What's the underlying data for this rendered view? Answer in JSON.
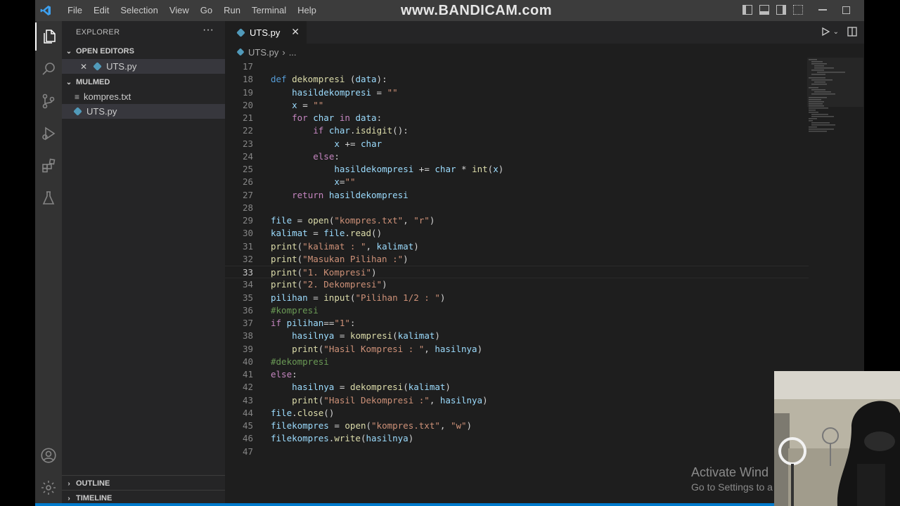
{
  "watermark": "www.BANDICAM.com",
  "menu": [
    "File",
    "Edit",
    "Selection",
    "View",
    "Go",
    "Run",
    "Terminal",
    "Help"
  ],
  "sidebar": {
    "title": "EXPLORER",
    "more": "···",
    "open_editors_label": "OPEN EDITORS",
    "open_editor_file": "UTS.py",
    "folder_label": "MULMED",
    "files": [
      "kompres.txt",
      "UTS.py"
    ],
    "outline_label": "OUTLINE",
    "timeline_label": "TIMELINE"
  },
  "tab": {
    "label": "UTS.py",
    "close": "✕"
  },
  "breadcrumb": {
    "file": "UTS.py",
    "sep": "›",
    "rest": "..."
  },
  "code_lines": [
    {
      "n": "17",
      "text": ""
    },
    {
      "n": "18",
      "text": "def dekompresi (data):"
    },
    {
      "n": "19",
      "text": "    hasildekompresi = \"\""
    },
    {
      "n": "20",
      "text": "    x = \"\""
    },
    {
      "n": "21",
      "text": "    for char in data:"
    },
    {
      "n": "22",
      "text": "        if char.isdigit():"
    },
    {
      "n": "23",
      "text": "            x += char"
    },
    {
      "n": "24",
      "text": "        else:"
    },
    {
      "n": "25",
      "text": "            hasildekompresi += char * int(x)"
    },
    {
      "n": "26",
      "text": "            x=\"\""
    },
    {
      "n": "27",
      "text": "    return hasildekompresi"
    },
    {
      "n": "28",
      "text": ""
    },
    {
      "n": "29",
      "text": "file = open(\"kompres.txt\", \"r\")"
    },
    {
      "n": "30",
      "text": "kalimat = file.read()"
    },
    {
      "n": "31",
      "text": "print(\"kalimat : \", kalimat)"
    },
    {
      "n": "32",
      "text": "print(\"Masukan Pilihan :\")"
    },
    {
      "n": "33",
      "text": "print(\"1. Kompresi\")"
    },
    {
      "n": "34",
      "text": "print(\"2. Dekompresi\")"
    },
    {
      "n": "35",
      "text": "pilihan = input(\"Pilihan 1/2 : \")"
    },
    {
      "n": "36",
      "text": "#kompresi"
    },
    {
      "n": "37",
      "text": "if pilihan==\"1\":"
    },
    {
      "n": "38",
      "text": "    hasilnya = kompresi(kalimat)"
    },
    {
      "n": "39",
      "text": "    print(\"Hasil Kompresi : \", hasilnya)"
    },
    {
      "n": "40",
      "text": "#dekompresi"
    },
    {
      "n": "41",
      "text": "else:"
    },
    {
      "n": "42",
      "text": "    hasilnya = dekompresi(kalimat)"
    },
    {
      "n": "43",
      "text": "    print(\"Hasil Dekompresi :\", hasilnya)"
    },
    {
      "n": "44",
      "text": "file.close()"
    },
    {
      "n": "45",
      "text": "filekompres = open(\"kompres.txt\", \"w\")"
    },
    {
      "n": "46",
      "text": "filekompres.write(hasilnya)"
    },
    {
      "n": "47",
      "text": ""
    }
  ],
  "current_line": "33",
  "activation": {
    "line1": "Activate Wind",
    "line2": "Go to Settings to a"
  },
  "colors": {
    "accent": "#007acc",
    "keyword": "#569cd6",
    "control": "#c586c0",
    "function": "#dcdcaa",
    "string": "#ce9178",
    "variable": "#9cdcfe",
    "comment": "#6a9955"
  }
}
